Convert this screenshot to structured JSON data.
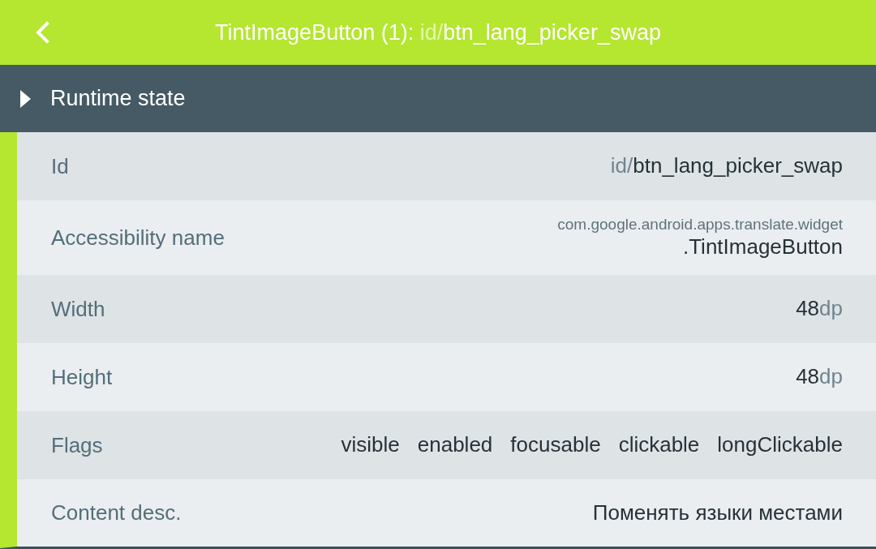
{
  "header": {
    "title_parts": [
      {
        "text": "TintImageButton (1): ",
        "muted": false
      },
      {
        "text": "id/",
        "muted": true
      },
      {
        "text": "btn_lang_picker_swap",
        "muted": false
      }
    ]
  },
  "section": {
    "title": "Runtime state"
  },
  "rows": [
    {
      "label": "Id",
      "kind": "inline",
      "parts": [
        {
          "text": "id/",
          "muted": true
        },
        {
          "text": "btn_lang_picker_swap",
          "muted": false
        }
      ]
    },
    {
      "label": "Accessibility name",
      "kind": "stacked",
      "parts": [
        {
          "text": "com.google.android.apps.translate.widget",
          "muted": true
        },
        {
          "text": ".TintImageButton",
          "muted": false
        }
      ]
    },
    {
      "label": "Width",
      "kind": "inline",
      "parts": [
        {
          "text": "48",
          "muted": false
        },
        {
          "text": "dp",
          "muted": true
        }
      ]
    },
    {
      "label": "Height",
      "kind": "inline",
      "parts": [
        {
          "text": "48",
          "muted": false
        },
        {
          "text": "dp",
          "muted": true
        }
      ]
    },
    {
      "label": "Flags",
      "kind": "flags",
      "flags": [
        "visible",
        "enabled",
        "focusable",
        "clickable",
        "longClickable"
      ]
    },
    {
      "label": "Content desc.",
      "kind": "inline",
      "parts": [
        {
          "text": "Поменять языки местами",
          "muted": false
        }
      ]
    }
  ]
}
